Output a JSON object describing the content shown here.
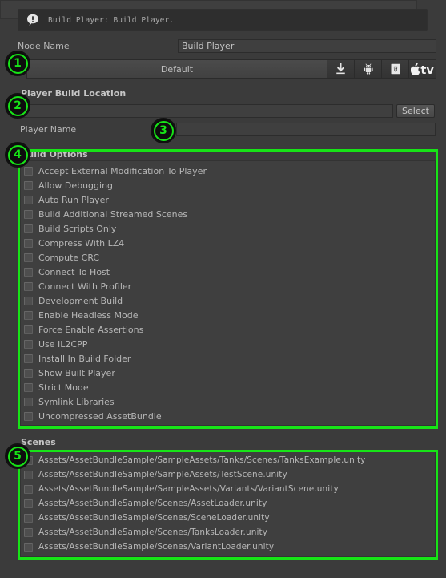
{
  "info_bar": {
    "icon": "info-exclamation-icon",
    "message": "Build Player: Build Player."
  },
  "node_name": {
    "label": "Node Name",
    "value": "Build Player"
  },
  "platform_bar": {
    "default_tab_label": "Default",
    "targets": [
      {
        "name": "standalone-icon",
        "title": "Standalone"
      },
      {
        "name": "android-icon",
        "title": "Android"
      },
      {
        "name": "webgl-html5-icon",
        "title": "WebGL"
      },
      {
        "name": "apple-tv-icon",
        "title": "tvOS"
      }
    ]
  },
  "player_build_location": {
    "title": "Player Build Location",
    "value": "",
    "select_label": "Select"
  },
  "player_name": {
    "label": "Player Name",
    "value": ""
  },
  "build_options": {
    "title": "Build Options",
    "items": [
      {
        "label": "Accept External Modification To Player",
        "checked": false
      },
      {
        "label": "Allow Debugging",
        "checked": false
      },
      {
        "label": "Auto Run Player",
        "checked": false
      },
      {
        "label": "Build Additional Streamed Scenes",
        "checked": false
      },
      {
        "label": "Build Scripts Only",
        "checked": false
      },
      {
        "label": "Compress With LZ4",
        "checked": false
      },
      {
        "label": "Compute CRC",
        "checked": false
      },
      {
        "label": "Connect To Host",
        "checked": false
      },
      {
        "label": "Connect With Profiler",
        "checked": false
      },
      {
        "label": "Development Build",
        "checked": false
      },
      {
        "label": "Enable Headless Mode",
        "checked": false
      },
      {
        "label": "Force Enable Assertions",
        "checked": false
      },
      {
        "label": "Use IL2CPP",
        "checked": false
      },
      {
        "label": "Install In Build Folder",
        "checked": false
      },
      {
        "label": "Show Built Player",
        "checked": false
      },
      {
        "label": "Strict Mode",
        "checked": false
      },
      {
        "label": "Symlink Libraries",
        "checked": false
      },
      {
        "label": "Uncompressed AssetBundle",
        "checked": false
      }
    ]
  },
  "scenes": {
    "title": "Scenes",
    "items": [
      {
        "label": "Assets/AssetBundleSample/SampleAssets/Tanks/Scenes/TanksExample.unity",
        "checked": false
      },
      {
        "label": "Assets/AssetBundleSample/SampleAssets/TestScene.unity",
        "checked": false
      },
      {
        "label": "Assets/AssetBundleSample/SampleAssets/Variants/VariantScene.unity",
        "checked": false
      },
      {
        "label": "Assets/AssetBundleSample/Scenes/AssetLoader.unity",
        "checked": false
      },
      {
        "label": "Assets/AssetBundleSample/Scenes/SceneLoader.unity",
        "checked": false
      },
      {
        "label": "Assets/AssetBundleSample/Scenes/TanksLoader.unity",
        "checked": false
      },
      {
        "label": "Assets/AssetBundleSample/Scenes/VariantLoader.unity",
        "checked": false
      }
    ]
  },
  "annotations": {
    "highlight_color": "#17e417",
    "markers": [
      {
        "id": "1",
        "label": "1"
      },
      {
        "id": "2",
        "label": "2"
      },
      {
        "id": "3",
        "label": "3"
      },
      {
        "id": "4",
        "label": "4"
      },
      {
        "id": "5",
        "label": "5"
      }
    ]
  },
  "colors": {
    "window_bg": "#3b3b3b",
    "panel_bg": "#3f3f3f",
    "info_bar_bg": "#2e2e2e",
    "text": "#b8b8b8",
    "accent_green": "#17e417"
  }
}
